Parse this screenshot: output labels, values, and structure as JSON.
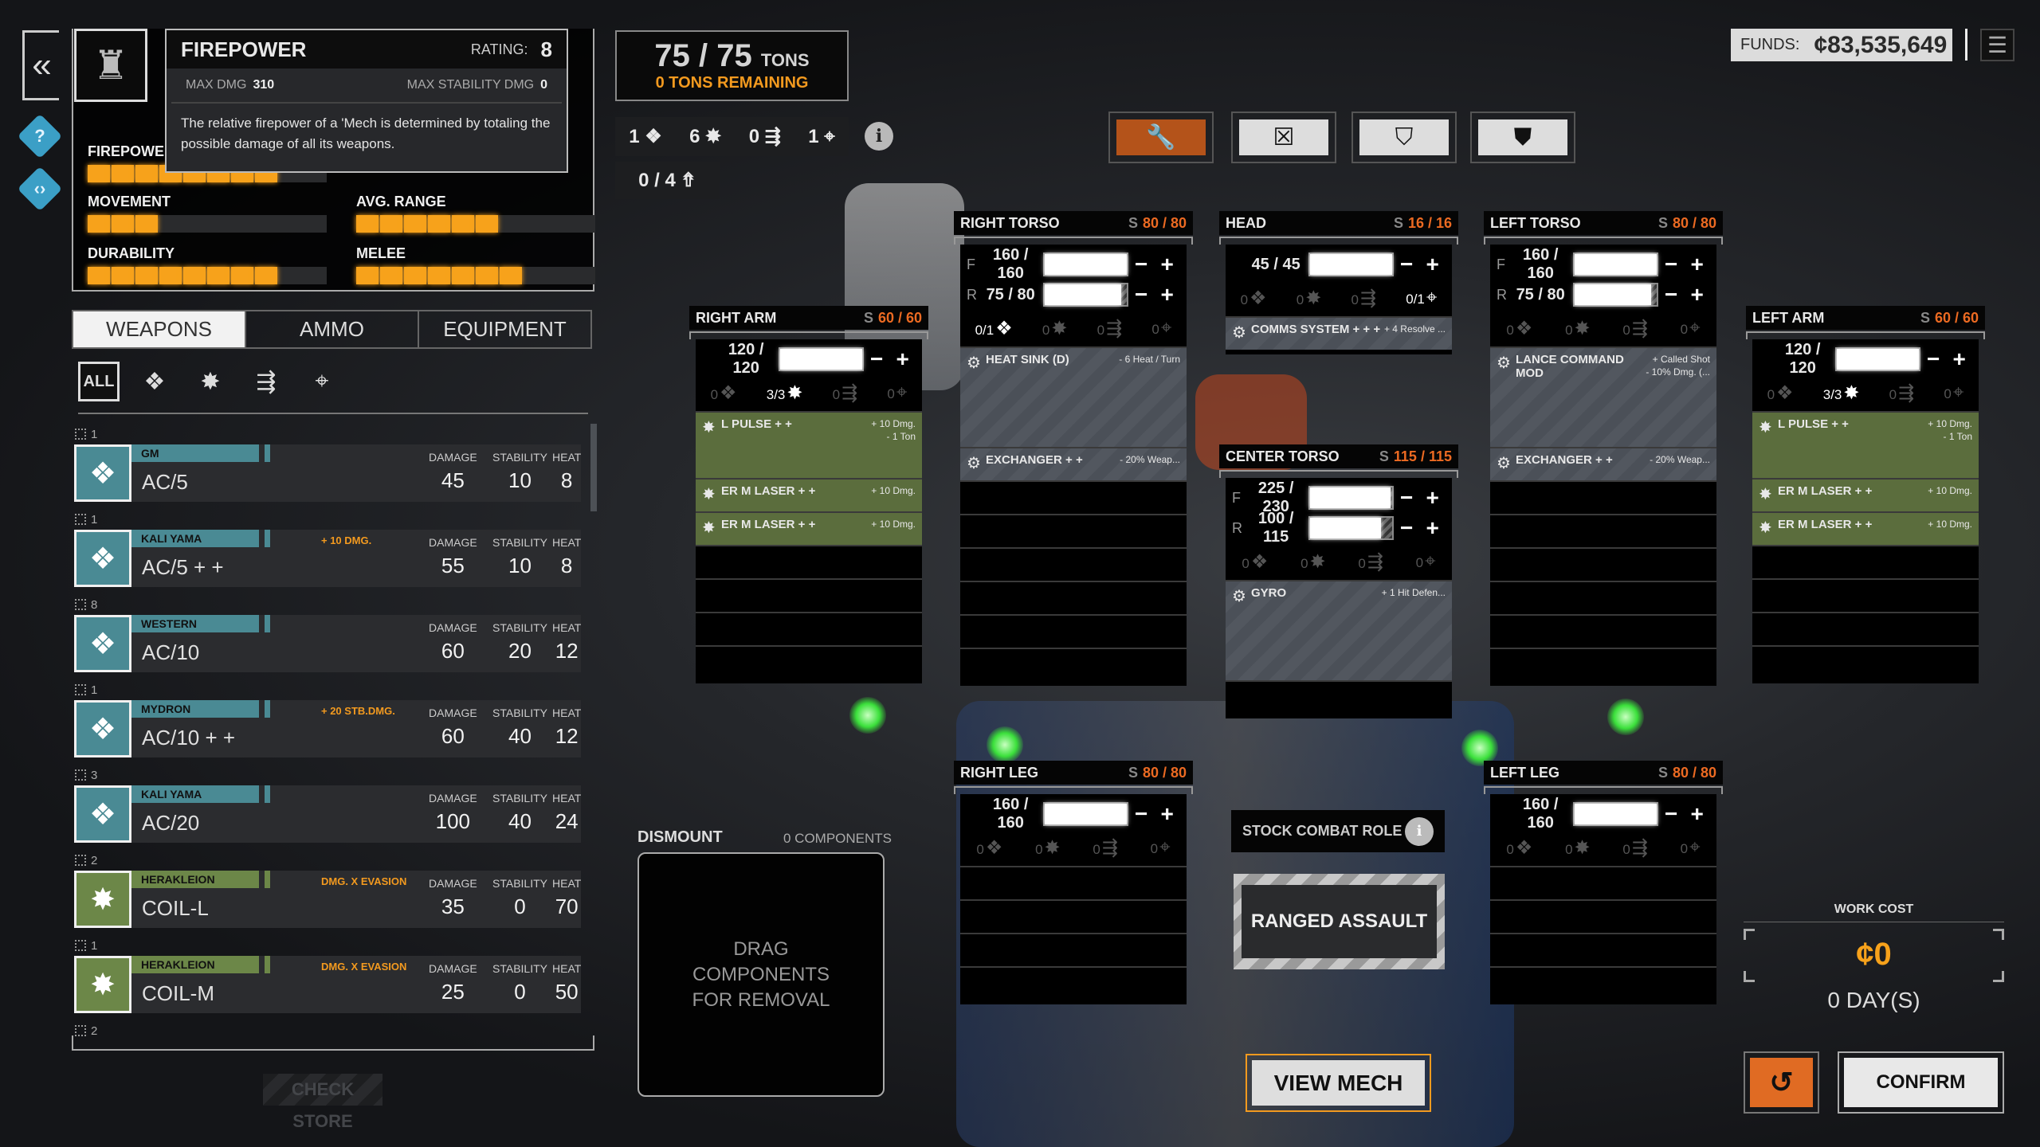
{
  "colors": {
    "accent": "#f7a21b",
    "structure": "#ec6a22",
    "ballistic": "#4a8a94",
    "energy": "#5b6d3d",
    "equipment": "#4b5058",
    "active_tool": "#b4531a"
  },
  "nav": {
    "back_icon": "double-chevron-left-icon",
    "help_icon": "question-icon",
    "code_icon": "diamond-code-icon"
  },
  "mech_thumbnail_icon": "mech-icon",
  "tooltip": {
    "title": "FIREPOWER",
    "rating_label": "RATING:",
    "rating": "8",
    "max_dmg_label": "MAX DMG",
    "max_dmg": "310",
    "max_stab_label": "MAX STABILITY DMG",
    "max_stab": "0",
    "description": "The relative firepower of a 'Mech is determined by totaling the possible damage of all its weapons."
  },
  "stats": [
    {
      "label": "FIREPOWER",
      "rating": 8
    },
    {
      "label": "MOVEMENT",
      "rating": 3
    },
    {
      "label": "AVG. RANGE",
      "rating": 6
    },
    {
      "label": "DURABILITY",
      "rating": 8
    },
    {
      "label": "MELEE",
      "rating": 7
    }
  ],
  "stat_max": 10,
  "tabs": [
    {
      "label": "WEAPONS",
      "active": true
    },
    {
      "label": "AMMO"
    },
    {
      "label": "EQUIPMENT"
    }
  ],
  "filters": {
    "all": "ALL",
    "icons": [
      "ballistic-icon",
      "energy-icon",
      "missile-icon",
      "support-icon"
    ]
  },
  "weapon_headers": {
    "damage": "DAMAGE",
    "stability": "STABILITY",
    "heat": "HEAT"
  },
  "weapons": [
    {
      "count": "1",
      "type": "ballistic",
      "mfr": "GM",
      "name": "AC/5",
      "bonus": "",
      "damage": "45",
      "stability": "10",
      "heat": "8"
    },
    {
      "count": "1",
      "type": "ballistic",
      "mfr": "KALI YAMA",
      "name": "AC/5 + +",
      "bonus": "+ 10 DMG.",
      "damage": "55",
      "stability": "10",
      "heat": "8"
    },
    {
      "count": "8",
      "type": "ballistic",
      "mfr": "WESTERN",
      "name": "AC/10",
      "bonus": "",
      "damage": "60",
      "stability": "20",
      "heat": "12"
    },
    {
      "count": "1",
      "type": "ballistic",
      "mfr": "MYDRON",
      "name": "AC/10 + +",
      "bonus": "+ 20 STB.DMG.",
      "damage": "60",
      "stability": "40",
      "heat": "12"
    },
    {
      "count": "3",
      "type": "ballistic",
      "mfr": "KALI YAMA",
      "name": "AC/20",
      "bonus": "",
      "damage": "100",
      "stability": "40",
      "heat": "24"
    },
    {
      "count": "2",
      "type": "energy",
      "mfr": "HERAKLEION",
      "name": "COIL-L",
      "bonus": "DMG. X EVASION",
      "damage": "35",
      "stability": "0",
      "heat": "70"
    },
    {
      "count": "1",
      "type": "energy",
      "mfr": "HERAKLEION",
      "name": "COIL-M",
      "bonus": "DMG. X EVASION",
      "damage": "25",
      "stability": "0",
      "heat": "50"
    },
    {
      "count": "2",
      "type": "energy"
    }
  ],
  "check_store": "CHECK STORE",
  "tonnage": {
    "value": "75 / 75",
    "unit": "TONS",
    "remaining": "0 TONS REMAINING"
  },
  "hardpoint_totals": [
    {
      "type": "ballistic",
      "value": "1"
    },
    {
      "type": "energy",
      "value": "6"
    },
    {
      "type": "missile",
      "value": "0"
    },
    {
      "type": "support",
      "value": "1"
    }
  ],
  "jump_jets": "0 / 4",
  "info": "i",
  "toolbar": [
    {
      "icon": "wrench-icon",
      "glyph": "🔧",
      "active": true
    },
    {
      "icon": "strip-armor-icon",
      "glyph": "☒"
    },
    {
      "icon": "strip-structure-icon",
      "glyph": "⛉"
    },
    {
      "icon": "max-armor-icon",
      "glyph": "⛊"
    }
  ],
  "funds": {
    "label": "FUNDS:",
    "value": "¢83,535,649"
  },
  "menu_icon": "hamburger-menu-icon",
  "locations": [
    {
      "name": "RIGHT ARM",
      "s": "S",
      "structure": "60 / 60",
      "armor": [
        {
          "side": "",
          "value": "120 / 120"
        }
      ],
      "hardpoints": [
        {
          "type": "ballistic",
          "value": "0"
        },
        {
          "type": "energy",
          "value": "3/3",
          "on": true
        },
        {
          "type": "missile",
          "value": "0"
        },
        {
          "type": "support",
          "value": "0"
        }
      ],
      "slots_total": 8,
      "slots": [
        {
          "name": "L PULSE + +",
          "bonus": [
            "+ 10 Dmg.",
            "- 1 Ton"
          ],
          "size": 2,
          "type": "en"
        },
        {
          "name": "ER M LASER + +",
          "bonus": [
            "+ 10 Dmg."
          ],
          "size": 1,
          "type": "en"
        },
        {
          "name": "ER M LASER + +",
          "bonus": [
            "+ 10 Dmg."
          ],
          "size": 1,
          "type": "en"
        }
      ]
    },
    {
      "name": "RIGHT TORSO",
      "s": "S",
      "structure": "80 / 80",
      "armor": [
        {
          "side": "F",
          "value": "160 / 160"
        },
        {
          "side": "R",
          "value": "75 / 80"
        }
      ],
      "hardpoints": [
        {
          "type": "ballistic",
          "value": "0/1",
          "on": true
        },
        {
          "type": "energy",
          "value": "0"
        },
        {
          "type": "missile",
          "value": "0"
        },
        {
          "type": "support",
          "value": "0"
        }
      ],
      "slots_total": 10,
      "slots": [
        {
          "name": "HEAT SINK (D)",
          "bonus": [
            "- 6 Heat / Turn"
          ],
          "size": 3,
          "type": "eq"
        },
        {
          "name": "EXCHANGER + +",
          "bonus": [
            "- 20% Weap..."
          ],
          "size": 1,
          "type": "eq"
        }
      ]
    },
    {
      "name": "HEAD",
      "s": "S",
      "structure": "16 / 16",
      "armor": [
        {
          "side": "",
          "value": "45 / 45"
        }
      ],
      "hardpoints": [
        {
          "type": "ballistic",
          "value": "0"
        },
        {
          "type": "energy",
          "value": "0"
        },
        {
          "type": "missile",
          "value": "0"
        },
        {
          "type": "support",
          "value": "0/1",
          "on": true
        }
      ],
      "slots_total": 1,
      "slots": [
        {
          "name": "COMMS SYSTEM + + +",
          "bonus": [
            "+ 4 Resolve ..."
          ],
          "size": 1,
          "type": "eq"
        }
      ]
    },
    {
      "name": "CENTER TORSO",
      "s": "S",
      "structure": "115 / 115",
      "armor": [
        {
          "side": "F",
          "value": "225 / 230"
        },
        {
          "side": "R",
          "value": "100 / 115"
        }
      ],
      "hardpoints": [
        {
          "type": "ballistic",
          "value": "0"
        },
        {
          "type": "energy",
          "value": "0"
        },
        {
          "type": "missile",
          "value": "0"
        },
        {
          "type": "support",
          "value": "0"
        }
      ],
      "slots_total": 4,
      "slots": [
        {
          "name": "GYRO",
          "bonus": [
            "+ 1 Hit Defen..."
          ],
          "size": 3,
          "type": "eq"
        }
      ]
    },
    {
      "name": "LEFT TORSO",
      "s": "S",
      "structure": "80 / 80",
      "armor": [
        {
          "side": "F",
          "value": "160 / 160"
        },
        {
          "side": "R",
          "value": "75 / 80"
        }
      ],
      "hardpoints": [
        {
          "type": "ballistic",
          "value": "0"
        },
        {
          "type": "energy",
          "value": "0"
        },
        {
          "type": "missile",
          "value": "0"
        },
        {
          "type": "support",
          "value": "0"
        }
      ],
      "slots_total": 10,
      "slots": [
        {
          "name": "LANCE COMMAND MOD",
          "bonus": [
            "+ Called Shot",
            "- 10% Dmg. (..."
          ],
          "size": 3,
          "type": "eq"
        },
        {
          "name": "EXCHANGER + +",
          "bonus": [
            "- 20% Weap..."
          ],
          "size": 1,
          "type": "eq"
        }
      ]
    },
    {
      "name": "LEFT ARM",
      "s": "S",
      "structure": "60 / 60",
      "armor": [
        {
          "side": "",
          "value": "120 / 120"
        }
      ],
      "hardpoints": [
        {
          "type": "ballistic",
          "value": "0"
        },
        {
          "type": "energy",
          "value": "3/3",
          "on": true
        },
        {
          "type": "missile",
          "value": "0"
        },
        {
          "type": "support",
          "value": "0"
        }
      ],
      "slots_total": 8,
      "slots": [
        {
          "name": "L PULSE + +",
          "bonus": [
            "+ 10 Dmg.",
            "- 1 Ton"
          ],
          "size": 2,
          "type": "en"
        },
        {
          "name": "ER M LASER + +",
          "bonus": [
            "+ 10 Dmg."
          ],
          "size": 1,
          "type": "en"
        },
        {
          "name": "ER M LASER + +",
          "bonus": [
            "+ 10 Dmg."
          ],
          "size": 1,
          "type": "en"
        }
      ]
    },
    {
      "name": "RIGHT LEG",
      "s": "S",
      "structure": "80 / 80",
      "armor": [
        {
          "side": "",
          "value": "160 / 160"
        }
      ],
      "hardpoints": [
        {
          "type": "ballistic",
          "value": "0"
        },
        {
          "type": "energy",
          "value": "0"
        },
        {
          "type": "missile",
          "value": "0"
        },
        {
          "type": "support",
          "value": "0"
        }
      ],
      "slots_total": 4,
      "slots": []
    },
    {
      "name": "LEFT LEG",
      "s": "S",
      "structure": "80 / 80",
      "armor": [
        {
          "side": "",
          "value": "160 / 160"
        }
      ],
      "hardpoints": [
        {
          "type": "ballistic",
          "value": "0"
        },
        {
          "type": "energy",
          "value": "0"
        },
        {
          "type": "missile",
          "value": "0"
        },
        {
          "type": "support",
          "value": "0"
        }
      ],
      "slots_total": 4,
      "slots": []
    }
  ],
  "combat_role": {
    "label": "STOCK COMBAT ROLE",
    "info": "i",
    "value": "RANGED ASSAULT"
  },
  "view_mech": "VIEW MECH",
  "dismount": {
    "label": "DISMOUNT",
    "count": "0 COMPONENTS",
    "hint": "DRAG COMPONENTS FOR REMOVAL"
  },
  "work_cost": {
    "label": "WORK COST",
    "value": "¢0",
    "days": "0 DAY(S)"
  },
  "undo_icon": "undo-icon",
  "confirm": "CONFIRM"
}
